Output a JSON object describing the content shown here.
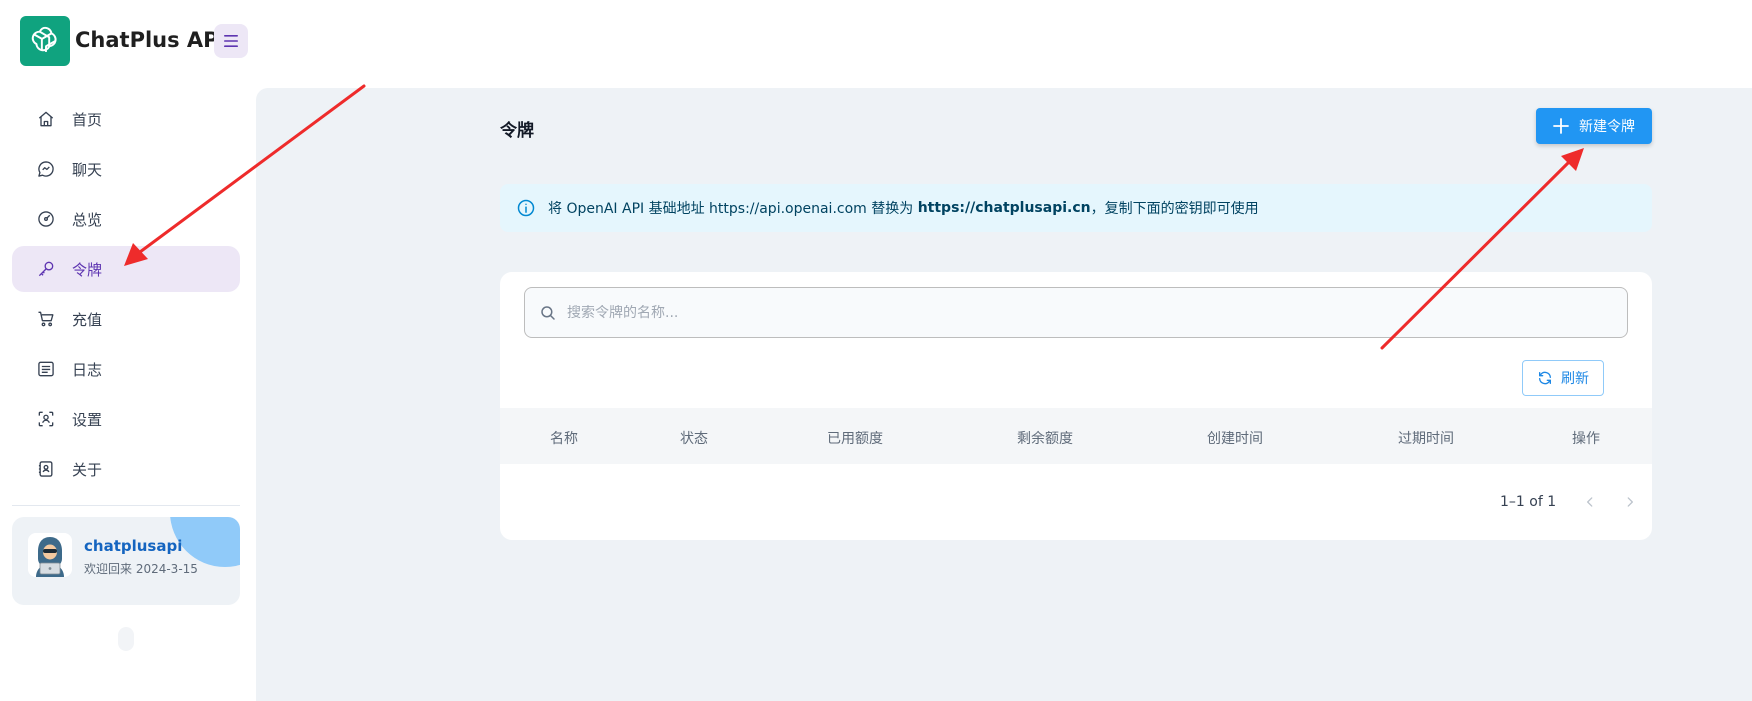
{
  "header": {
    "brand": "ChatPlus API"
  },
  "sidebar": {
    "items": [
      {
        "label": "首页",
        "icon": "home-icon"
      },
      {
        "label": "聊天",
        "icon": "chat-icon"
      },
      {
        "label": "总览",
        "icon": "dashboard-icon"
      },
      {
        "label": "令牌",
        "icon": "key-icon",
        "active": true
      },
      {
        "label": "充值",
        "icon": "cart-icon"
      },
      {
        "label": "日志",
        "icon": "log-icon"
      },
      {
        "label": "设置",
        "icon": "settings-icon"
      },
      {
        "label": "关于",
        "icon": "about-icon"
      }
    ],
    "user": {
      "name": "chatplusapi",
      "welcome": "欢迎回来 2024-3-15"
    }
  },
  "main": {
    "title": "令牌",
    "new_button": "新建令牌",
    "alert": {
      "prefix": "将 OpenAI API 基础地址 https://api.openai.com 替换为 ",
      "highlight": "https://chatplusapi.cn",
      "suffix": "，复制下面的密钥即可使用"
    },
    "search_placeholder": "搜索令牌的名称...",
    "refresh_button": "刷新",
    "table": {
      "columns": [
        "名称",
        "状态",
        "已用额度",
        "剩余额度",
        "创建时间",
        "过期时间",
        "操作"
      ]
    },
    "pagination": "1–1 of 1"
  },
  "colors": {
    "brand_green": "#10a37f",
    "primary": "#2196f3",
    "active_nav_bg": "#ede7f6",
    "active_nav_text": "#5e35b1",
    "annotation_red": "#ee2b2b"
  }
}
